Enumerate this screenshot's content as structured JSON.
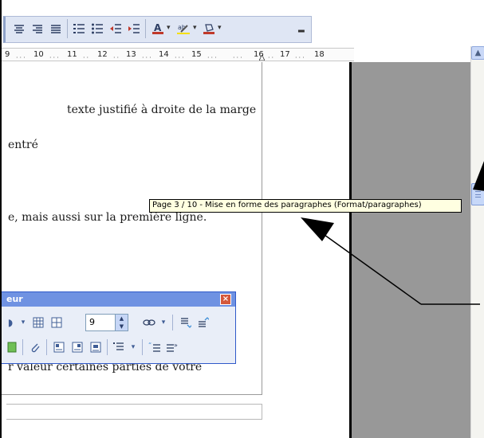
{
  "toolbar": {
    "buttons": [
      {
        "name": "align-center-icon",
        "glyph": "≡"
      },
      {
        "name": "align-right-icon",
        "glyph": "≡"
      },
      {
        "name": "justify-icon",
        "glyph": "≡"
      },
      {
        "name": "numbered-list-icon",
        "glyph": "⁝≡"
      },
      {
        "name": "bullet-list-icon",
        "glyph": "⁚≡"
      },
      {
        "name": "decrease-indent-icon",
        "glyph": "⇤"
      },
      {
        "name": "increase-indent-icon",
        "glyph": "⇥"
      },
      {
        "name": "font-color-icon",
        "glyph": "A"
      },
      {
        "name": "highlight-icon",
        "glyph": "ab"
      },
      {
        "name": "background-color-icon",
        "glyph": "◈"
      }
    ],
    "accent_color": "#c0392b"
  },
  "ruler": {
    "labels": [
      "9",
      "10",
      "11",
      "12",
      "13",
      "14",
      "15",
      "16",
      "17",
      "18"
    ]
  },
  "document": {
    "line1": "texte justifié à droite de la marge",
    "line2": "entré",
    "line3": "e, mais aussi sur la première ligne.",
    "line4": "r valeur certaines parties de votre"
  },
  "tooltip": {
    "text": "Page 3 / 10  - Mise en forme des paragraphes (Format/paragraphes)"
  },
  "floating_toolbar": {
    "title": "eur",
    "font_size_value": "9",
    "close_label": "×"
  },
  "scrollbar": {
    "up_glyph": "▲"
  }
}
